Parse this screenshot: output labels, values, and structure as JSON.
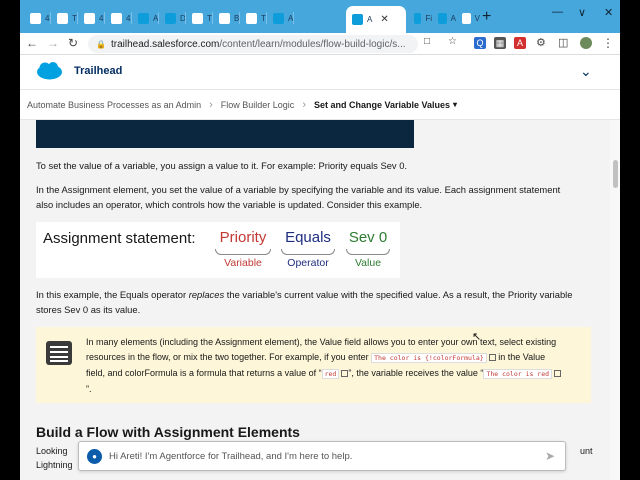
{
  "browser": {
    "tabs": [
      {
        "label": "4",
        "color": "#1b6fb0"
      },
      {
        "label": "T",
        "color": "#1b6fb0"
      },
      {
        "label": "4",
        "color": "#1b6fb0"
      },
      {
        "label": "4",
        "color": "#1b6fb0"
      },
      {
        "label": "A",
        "color": "#0d9dda"
      },
      {
        "label": "D",
        "color": "#0d9dda"
      },
      {
        "label": "T",
        "color": "#1b6fb0"
      },
      {
        "label": "B",
        "color": "#1b6fb0"
      },
      {
        "label": "T",
        "color": "#1b6fb0"
      },
      {
        "label": "A",
        "color": "#0d9dda"
      }
    ],
    "active_tab": {
      "label": "A",
      "close": "✕",
      "color": "#0d9dda"
    },
    "after_tabs": [
      {
        "label": "Fi",
        "color": "#0d9dda"
      },
      {
        "label": "A",
        "color": "#0d9dda"
      },
      {
        "label": "V",
        "color": "#b54a4a"
      }
    ],
    "new_tab": "+",
    "url_host": "trailhead.salesforce.com",
    "url_path": "/content/learn/modules/flow-build-logic/s..."
  },
  "header": {
    "brand": "Trailhead",
    "brand_color": "#00a1e0"
  },
  "breadcrumb": {
    "items": [
      "Automate Business Processes as an Admin",
      "Flow Builder Logic"
    ],
    "current": "Set and Change Variable Values",
    "caret": "▾"
  },
  "content": {
    "para1": "To set the value of a variable, you assign a value to it. For example: Priority equals Sev 0.",
    "para2": "In the Assignment element, you set the value of a variable by specifying the variable and its value. Each assignment statement also includes an operator, which controls how the variable is updated. Consider this example.",
    "figure": {
      "lead": "Assignment statement:",
      "parts": [
        {
          "word": "Priority",
          "sub": "Variable",
          "color": "#c23934"
        },
        {
          "word": "Equals",
          "sub": "Operator",
          "color": "#1f2d80"
        },
        {
          "word": "Sev 0",
          "sub": "Value",
          "color": "#2e7d32"
        }
      ]
    },
    "para3_a": "In this example, the Equals operator ",
    "para3_em": "replaces",
    "para3_b": " the variable's current value with the specified value. As a result, the Priority variable stores Sev 0 as its value.",
    "note": {
      "t1": "In many elements (including the Assignment element), the Value field allows you to enter your own text, select existing resources in the flow, or mix the two together. For example, if you enter ",
      "code1": "The color is {!colorFormula}",
      "t2": " in the Value field, and colorFormula is a formula that returns a value of “",
      "code2": "red",
      "t3": "”, the variable receives the value “",
      "code3": "The color is red",
      "t4": "”."
    },
    "section_heading": "Build a Flow with Assignment Elements",
    "cut_left": "Looking",
    "cut_right": "unt",
    "cut_line2": "Lightning"
  },
  "chat": {
    "avatar": "●",
    "placeholder": "Hi Areti! I'm Agentforce for Trailhead, and I'm here to help.",
    "send": "➤"
  }
}
